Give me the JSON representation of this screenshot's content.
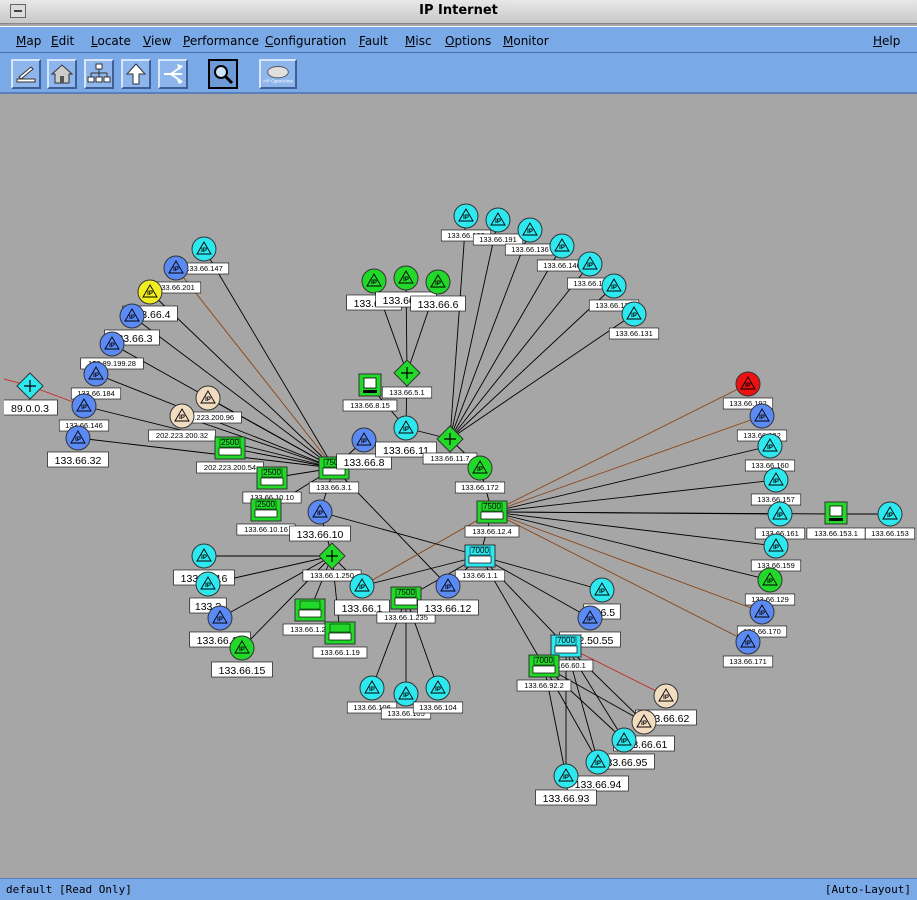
{
  "window": {
    "title": "IP Internet"
  },
  "menu": [
    "Map",
    "Edit",
    "Locate",
    "View",
    "Performance",
    "Configuration",
    "Fault",
    "Misc",
    "Options",
    "Monitor"
  ],
  "help": "Help",
  "toolbar": [
    {
      "icon": "close-submap-icon"
    },
    {
      "icon": "home-submap-icon"
    },
    {
      "icon": "root-submap-icon"
    },
    {
      "icon": "parent-submap-icon"
    },
    {
      "icon": "quick-navigator-icon"
    },
    {
      "icon": "pan-zoom-icon",
      "active": true
    },
    {
      "icon": "hp-openview-logo",
      "label": "HP OpenView"
    }
  ],
  "status": {
    "left": "default [Read Only]",
    "right": "[Auto-Layout]"
  },
  "colors": {
    "cyan": "#2ee8f0",
    "blue": "#5b8af5",
    "green": "#22d92a",
    "yellow": "#f0ee22",
    "beige": "#f2dcc0",
    "red": "#ee1111",
    "line": "#000000",
    "brownline": "#8b4513",
    "redline": "#cc2222"
  },
  "nodes": [
    {
      "id": "n89",
      "kind": "ipnet-diamond",
      "color": "cyan",
      "label": "89.0.0.3",
      "big": true
    },
    {
      "id": "n1",
      "kind": "ipnet",
      "color": "cyan",
      "label": "133.66.147"
    },
    {
      "id": "n2",
      "kind": "ipnet",
      "color": "blue",
      "label": "133.66.201"
    },
    {
      "id": "n3",
      "kind": "ipnet",
      "color": "yellow",
      "label": "133.66.4",
      "big": true
    },
    {
      "id": "n4",
      "kind": "ipnet",
      "color": "blue",
      "label": "133.66.3",
      "big": true
    },
    {
      "id": "n5",
      "kind": "ipnet",
      "color": "blue",
      "label": "150.89.199.28"
    },
    {
      "id": "n6",
      "kind": "ipnet",
      "color": "blue",
      "label": "133.66.184"
    },
    {
      "id": "n7",
      "kind": "ipnet",
      "color": "blue",
      "label": "133.66.146"
    },
    {
      "id": "n8",
      "kind": "ipnet",
      "color": "blue",
      "label": "133.66.32",
      "big": true
    },
    {
      "id": "n9",
      "kind": "ipnet",
      "color": "beige",
      "label": "202.223.200.96"
    },
    {
      "id": "n10",
      "kind": "ipnet",
      "color": "beige",
      "label": "202.223.200.32"
    },
    {
      "id": "r1",
      "kind": "router",
      "color": "green",
      "label": "202.223.200.54",
      "model": "2500"
    },
    {
      "id": "r2",
      "kind": "router",
      "color": "green",
      "label": "133.66.10.10",
      "model": "2500"
    },
    {
      "id": "r3",
      "kind": "router",
      "color": "green",
      "label": "133.66.10.16",
      "model": "2500"
    },
    {
      "id": "r4",
      "kind": "router",
      "color": "green",
      "label": "133.66.3.1",
      "model": "7500"
    },
    {
      "id": "n11",
      "kind": "ipnet",
      "color": "blue",
      "label": "133.66.8",
      "big": true
    },
    {
      "id": "n12",
      "kind": "ipnet",
      "color": "blue",
      "label": "133.66.10",
      "big": true
    },
    {
      "id": "n13",
      "kind": "ipnet",
      "color": "green",
      "label": "133.66.?",
      "big": true
    },
    {
      "id": "n14",
      "kind": "ipnet",
      "color": "green",
      "label": "133.66.14",
      "big": true
    },
    {
      "id": "n15",
      "kind": "ipnet",
      "color": "green",
      "label": "133.66.6",
      "big": true
    },
    {
      "id": "d1",
      "kind": "ipnet-diamond",
      "color": "green",
      "label": "133.66.5.1"
    },
    {
      "id": "h1",
      "kind": "host",
      "color": "green",
      "label": "133.66.8.15"
    },
    {
      "id": "n16",
      "kind": "ipnet",
      "color": "cyan",
      "label": "133.66.11",
      "big": true
    },
    {
      "id": "d2",
      "kind": "ipnet-diamond",
      "color": "green",
      "label": "133.66.11.7"
    },
    {
      "id": "n17",
      "kind": "ipnet",
      "color": "green",
      "label": "133.66.172"
    },
    {
      "id": "c1",
      "kind": "ipnet",
      "color": "cyan",
      "label": "133.66.16?"
    },
    {
      "id": "c2",
      "kind": "ipnet",
      "color": "cyan",
      "label": "133.66.191"
    },
    {
      "id": "c3",
      "kind": "ipnet",
      "color": "cyan",
      "label": "133.66.136"
    },
    {
      "id": "c4",
      "kind": "ipnet",
      "color": "cyan",
      "label": "133.66.140"
    },
    {
      "id": "c5",
      "kind": "ipnet",
      "color": "cyan",
      "label": "133.66.1?"
    },
    {
      "id": "c6",
      "kind": "ipnet",
      "color": "cyan",
      "label": "133.66.130"
    },
    {
      "id": "c7",
      "kind": "ipnet",
      "color": "cyan",
      "label": "133.66.131"
    },
    {
      "id": "r5",
      "kind": "router",
      "color": "green",
      "label": "133.66.12.4",
      "model": "7500"
    },
    {
      "id": "e1",
      "kind": "ipnet",
      "color": "red",
      "label": "133.66.192"
    },
    {
      "id": "e2",
      "kind": "ipnet",
      "color": "blue",
      "label": "133.66.132"
    },
    {
      "id": "e3",
      "kind": "ipnet",
      "color": "cyan",
      "label": "133.66.160"
    },
    {
      "id": "e4",
      "kind": "ipnet",
      "color": "cyan",
      "label": "133.66.157"
    },
    {
      "id": "e5",
      "kind": "ipnet",
      "color": "cyan",
      "label": "133.66.161"
    },
    {
      "id": "h2",
      "kind": "host",
      "color": "green",
      "label": "133.66.153.1"
    },
    {
      "id": "e6",
      "kind": "ipnet",
      "color": "cyan",
      "label": "133.66.153"
    },
    {
      "id": "e7",
      "kind": "ipnet",
      "color": "cyan",
      "label": "133.66.159"
    },
    {
      "id": "e8",
      "kind": "ipnet",
      "color": "green",
      "label": "133.66.129"
    },
    {
      "id": "e9",
      "kind": "ipnet",
      "color": "blue",
      "label": "133.66.170"
    },
    {
      "id": "e10",
      "kind": "ipnet",
      "color": "blue",
      "label": "133.66.171"
    },
    {
      "id": "r6",
      "kind": "router",
      "color": "cyan",
      "label": "133.66.1.1",
      "model": "7000"
    },
    {
      "id": "d3",
      "kind": "ipnet-diamond",
      "color": "green",
      "label": "133.66.1.250"
    },
    {
      "id": "s1",
      "kind": "ipnet",
      "color": "cyan",
      "label": "133.66.16",
      "big": true
    },
    {
      "id": "s2",
      "kind": "ipnet",
      "color": "cyan",
      "label": "133.?",
      "big": true
    },
    {
      "id": "s3",
      "kind": "ipnet",
      "color": "blue",
      "label": "133.66.13",
      "big": true
    },
    {
      "id": "s4",
      "kind": "ipnet",
      "color": "green",
      "label": "133.66.15",
      "big": true
    },
    {
      "id": "s5",
      "kind": "ipnet",
      "color": "cyan",
      "label": "133.66.1",
      "big": true
    },
    {
      "id": "r7",
      "kind": "router",
      "color": "green",
      "label": "133.66.1.20",
      "model": ""
    },
    {
      "id": "r8",
      "kind": "router",
      "color": "green",
      "label": "133.66.1.19",
      "model": ""
    },
    {
      "id": "r9",
      "kind": "router",
      "color": "green",
      "label": "133.66.1.235",
      "model": "7500"
    },
    {
      "id": "s6",
      "kind": "ipnet",
      "color": "blue",
      "label": "133.66.12",
      "big": true
    },
    {
      "id": "s7",
      "kind": "ipnet",
      "color": "cyan",
      "label": "133.66.106"
    },
    {
      "id": "s8",
      "kind": "ipnet",
      "color": "cyan",
      "label": "133.66.105"
    },
    {
      "id": "s9",
      "kind": "ipnet",
      "color": "cyan",
      "label": "133.66.104"
    },
    {
      "id": "t1",
      "kind": "ipnet",
      "color": "cyan",
      "label": "?66.5",
      "big": true
    },
    {
      "id": "t2",
      "kind": "ipnet",
      "color": "blue",
      "label": "192.50.55",
      "big": true
    },
    {
      "id": "r10",
      "kind": "router",
      "color": "cyan",
      "label": "133.66.60.1",
      "model": "7000"
    },
    {
      "id": "r11",
      "kind": "router",
      "color": "green",
      "label": "133.66.92.2",
      "model": "7000"
    },
    {
      "id": "t3",
      "kind": "ipnet",
      "color": "beige",
      "label": "133.66.62",
      "big": true
    },
    {
      "id": "t4",
      "kind": "ipnet",
      "color": "beige",
      "label": "133.66.61",
      "big": true
    },
    {
      "id": "t5",
      "kind": "ipnet",
      "color": "cyan",
      "label": "133.66.95",
      "big": true
    },
    {
      "id": "t6",
      "kind": "ipnet",
      "color": "cyan",
      "label": "133.66.94",
      "big": true
    },
    {
      "id": "t7",
      "kind": "ipnet",
      "color": "cyan",
      "label": "133.66.93",
      "big": true
    }
  ],
  "links": [
    [
      "r4",
      "n1",
      0
    ],
    [
      "r4",
      "n2",
      1
    ],
    [
      "r4",
      "n3",
      0
    ],
    [
      "r4",
      "n4",
      0
    ],
    [
      "r4",
      "n5",
      0
    ],
    [
      "r4",
      "n6",
      0
    ],
    [
      "r4",
      "n7",
      0
    ],
    [
      "r4",
      "n8",
      0
    ],
    [
      "r4",
      "n9",
      0
    ],
    [
      "r4",
      "n10",
      0
    ],
    [
      "r4",
      "r1",
      0
    ],
    [
      "r4",
      "r2",
      0
    ],
    [
      "r4",
      "r3",
      0
    ],
    [
      "r4",
      "n11",
      0
    ],
    [
      "r4",
      "n12",
      0
    ],
    [
      "r4",
      "s6",
      0
    ],
    [
      "n89",
      "n7",
      2
    ],
    [
      "n89",
      "n89l",
      2
    ],
    [
      "d1",
      "n13",
      0
    ],
    [
      "d1",
      "n14",
      0
    ],
    [
      "d1",
      "n15",
      0
    ],
    [
      "d1",
      "n16",
      0
    ],
    [
      "h1",
      "n16",
      0
    ],
    [
      "n16",
      "d2",
      0
    ],
    [
      "d2",
      "c1",
      0
    ],
    [
      "d2",
      "c2",
      0
    ],
    [
      "d2",
      "c3",
      0
    ],
    [
      "d2",
      "c4",
      0
    ],
    [
      "d2",
      "c5",
      0
    ],
    [
      "d2",
      "c6",
      0
    ],
    [
      "d2",
      "c7",
      0
    ],
    [
      "d2",
      "n17",
      0
    ],
    [
      "n17",
      "r5",
      0
    ],
    [
      "r5",
      "e1",
      1
    ],
    [
      "r5",
      "e2",
      1
    ],
    [
      "r5",
      "e3",
      0
    ],
    [
      "r5",
      "e4",
      0
    ],
    [
      "r5",
      "e5",
      0
    ],
    [
      "r5",
      "h2",
      0
    ],
    [
      "h2",
      "e6",
      0
    ],
    [
      "r5",
      "e7",
      0
    ],
    [
      "r5",
      "e8",
      0
    ],
    [
      "r5",
      "e9",
      1
    ],
    [
      "r5",
      "e10",
      1
    ],
    [
      "r5",
      "r6",
      0
    ],
    [
      "r5",
      "s5",
      1
    ],
    [
      "n12",
      "r6",
      0
    ],
    [
      "n12",
      "d3",
      0
    ],
    [
      "d3",
      "s1",
      0
    ],
    [
      "d3",
      "s2",
      0
    ],
    [
      "d3",
      "s3",
      0
    ],
    [
      "d3",
      "s4",
      0
    ],
    [
      "d3",
      "s5",
      0
    ],
    [
      "d3",
      "r7",
      0
    ],
    [
      "d3",
      "r8",
      0
    ],
    [
      "r6",
      "s5",
      0
    ],
    [
      "r6",
      "r9",
      0
    ],
    [
      "r6",
      "s6",
      0
    ],
    [
      "r6",
      "t1",
      0
    ],
    [
      "r6",
      "t2",
      0
    ],
    [
      "r6",
      "r10",
      0
    ],
    [
      "r6",
      "r11",
      0
    ],
    [
      "r9",
      "s7",
      0
    ],
    [
      "r9",
      "s8",
      0
    ],
    [
      "r9",
      "s9",
      0
    ],
    [
      "r10",
      "t3",
      2
    ],
    [
      "r10",
      "t4",
      0
    ],
    [
      "r10",
      "t5",
      0
    ],
    [
      "r10",
      "t6",
      0
    ],
    [
      "r10",
      "t7",
      0
    ],
    [
      "r11",
      "t4",
      0
    ],
    [
      "r11",
      "t5",
      0
    ],
    [
      "r11",
      "t6",
      0
    ],
    [
      "r11",
      "t7",
      0
    ]
  ]
}
